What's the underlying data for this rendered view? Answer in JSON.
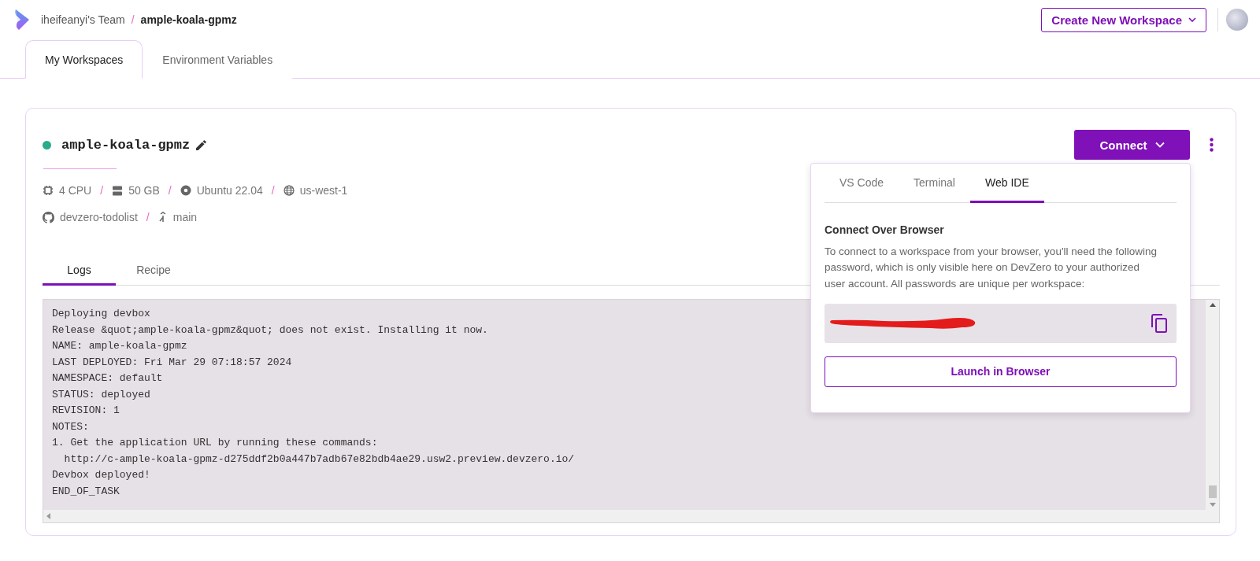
{
  "breadcrumb": {
    "team": "iheifeanyi's Team",
    "separator": "/",
    "workspace": "ample-koala-gpmz"
  },
  "create_button": {
    "label": "Create New Workspace"
  },
  "tabs": [
    {
      "label": "My Workspaces",
      "selected": true
    },
    {
      "label": "Environment Variables",
      "selected": false
    }
  ],
  "workspace": {
    "name": "ample-koala-gpmz",
    "specs": [
      {
        "kind": "cpu",
        "text": "4 CPU"
      },
      {
        "kind": "storage",
        "text": "50 GB",
        "separator": "/"
      },
      {
        "kind": "disc",
        "text": "Ubuntu 22.04",
        "separator": "/"
      },
      {
        "kind": "globe",
        "text": "us-west-1",
        "separator": "/"
      }
    ],
    "repo": [
      {
        "kind": "github",
        "text": "devzero-todolist"
      },
      {
        "kind": "branch",
        "text": "main",
        "separator": "/"
      }
    ],
    "connect_button": {
      "label": "Connect"
    },
    "log_tabs": [
      {
        "label": "Logs",
        "selected": true
      },
      {
        "label": "Recipe",
        "selected": false
      }
    ],
    "log_lines": [
      "Deploying devbox",
      "Release &quot;ample-koala-gpmz&quot; does not exist. Installing it now.",
      "NAME: ample-koala-gpmz",
      "LAST DEPLOYED: Fri Mar 29 07:18:57 2024",
      "NAMESPACE: default",
      "STATUS: deployed",
      "REVISION: 1",
      "NOTES:",
      "1. Get the application URL by running these commands:",
      "  http://c-ample-koala-gpmz-d275ddf2b0a447b7adb67e82bdb4ae29.usw2.preview.devzero.io/",
      "Devbox deployed!",
      "END_OF_TASK"
    ]
  },
  "connect_panel": {
    "tabs": [
      {
        "label": "VS Code",
        "selected": false
      },
      {
        "label": "Terminal",
        "selected": false
      },
      {
        "label": "Web IDE",
        "selected": true
      }
    ],
    "heading": "Connect Over Browser",
    "description": "To connect to a workspace from your browser, you'll need the following password, which is only visible here on DevZero to your authorized user account. All passwords are unique per workspace:",
    "launch_button": {
      "label": "Launch in Browser"
    }
  }
}
